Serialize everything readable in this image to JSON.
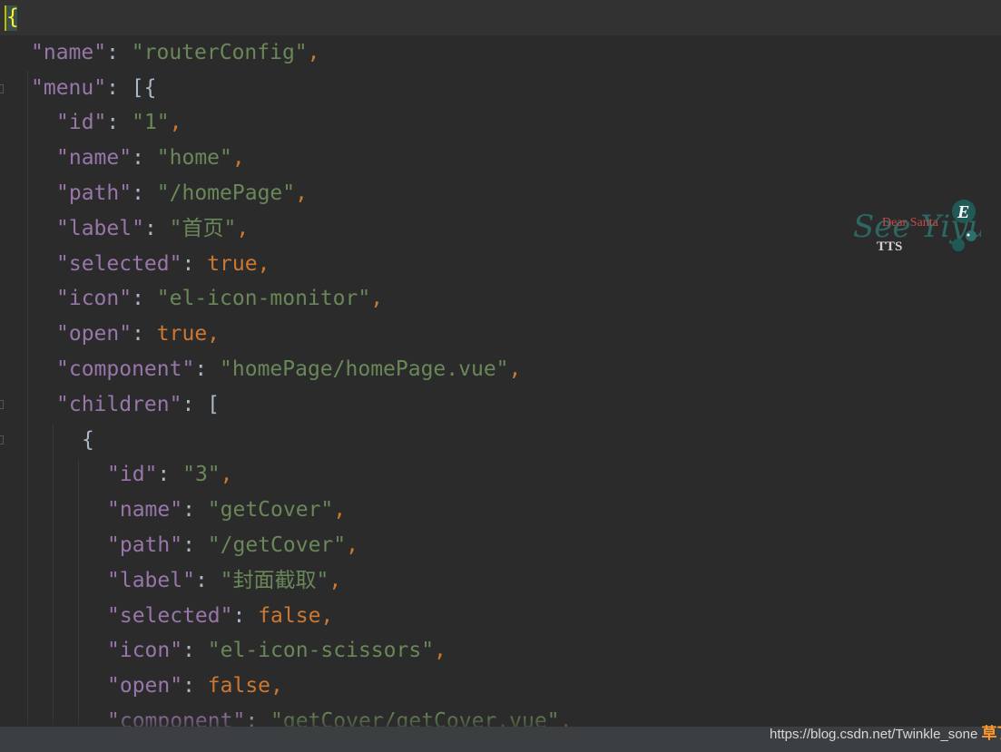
{
  "editor": {
    "lines": [
      {
        "indent": 0,
        "tokens": [
          {
            "t": "p",
            "v": "{"
          }
        ]
      },
      {
        "indent": 1,
        "tokens": [
          {
            "t": "k",
            "v": "\"name\""
          },
          {
            "t": "p",
            "v": ": "
          },
          {
            "t": "s",
            "v": "\"routerConfig\""
          },
          {
            "t": "b",
            "v": ","
          }
        ]
      },
      {
        "indent": 1,
        "tokens": [
          {
            "t": "k",
            "v": "\"menu\""
          },
          {
            "t": "p",
            "v": ": [{"
          }
        ]
      },
      {
        "indent": 2,
        "tokens": [
          {
            "t": "k",
            "v": "\"id\""
          },
          {
            "t": "p",
            "v": ": "
          },
          {
            "t": "s",
            "v": "\"1\""
          },
          {
            "t": "b",
            "v": ","
          }
        ]
      },
      {
        "indent": 2,
        "tokens": [
          {
            "t": "k",
            "v": "\"name\""
          },
          {
            "t": "p",
            "v": ": "
          },
          {
            "t": "s",
            "v": "\"home\""
          },
          {
            "t": "b",
            "v": ","
          }
        ]
      },
      {
        "indent": 2,
        "tokens": [
          {
            "t": "k",
            "v": "\"path\""
          },
          {
            "t": "p",
            "v": ": "
          },
          {
            "t": "s",
            "v": "\"/homePage\""
          },
          {
            "t": "b",
            "v": ","
          }
        ]
      },
      {
        "indent": 2,
        "tokens": [
          {
            "t": "k",
            "v": "\"label\""
          },
          {
            "t": "p",
            "v": ": "
          },
          {
            "t": "s",
            "v": "\"首页\""
          },
          {
            "t": "b",
            "v": ","
          }
        ]
      },
      {
        "indent": 2,
        "tokens": [
          {
            "t": "k",
            "v": "\"selected\""
          },
          {
            "t": "p",
            "v": ": "
          },
          {
            "t": "b",
            "v": "true,"
          }
        ]
      },
      {
        "indent": 2,
        "tokens": [
          {
            "t": "k",
            "v": "\"icon\""
          },
          {
            "t": "p",
            "v": ": "
          },
          {
            "t": "s",
            "v": "\"el-icon-monitor\""
          },
          {
            "t": "b",
            "v": ","
          }
        ]
      },
      {
        "indent": 2,
        "tokens": [
          {
            "t": "k",
            "v": "\"open\""
          },
          {
            "t": "p",
            "v": ": "
          },
          {
            "t": "b",
            "v": "true,"
          }
        ]
      },
      {
        "indent": 2,
        "tokens": [
          {
            "t": "k",
            "v": "\"component\""
          },
          {
            "t": "p",
            "v": ": "
          },
          {
            "t": "s",
            "v": "\"homePage/homePage.vue\""
          },
          {
            "t": "b",
            "v": ","
          }
        ]
      },
      {
        "indent": 2,
        "tokens": [
          {
            "t": "k",
            "v": "\"children\""
          },
          {
            "t": "p",
            "v": ": ["
          }
        ]
      },
      {
        "indent": 3,
        "tokens": [
          {
            "t": "p",
            "v": "{"
          }
        ]
      },
      {
        "indent": 4,
        "tokens": [
          {
            "t": "k",
            "v": "\"id\""
          },
          {
            "t": "p",
            "v": ": "
          },
          {
            "t": "s",
            "v": "\"3\""
          },
          {
            "t": "b",
            "v": ","
          }
        ]
      },
      {
        "indent": 4,
        "tokens": [
          {
            "t": "k",
            "v": "\"name\""
          },
          {
            "t": "p",
            "v": ": "
          },
          {
            "t": "s",
            "v": "\"getCover\""
          },
          {
            "t": "b",
            "v": ","
          }
        ]
      },
      {
        "indent": 4,
        "tokens": [
          {
            "t": "k",
            "v": "\"path\""
          },
          {
            "t": "p",
            "v": ": "
          },
          {
            "t": "s",
            "v": "\"/getCover\""
          },
          {
            "t": "b",
            "v": ","
          }
        ]
      },
      {
        "indent": 4,
        "tokens": [
          {
            "t": "k",
            "v": "\"label\""
          },
          {
            "t": "p",
            "v": ": "
          },
          {
            "t": "s",
            "v": "\"封面截取\""
          },
          {
            "t": "b",
            "v": ","
          }
        ]
      },
      {
        "indent": 4,
        "tokens": [
          {
            "t": "k",
            "v": "\"selected\""
          },
          {
            "t": "p",
            "v": ": "
          },
          {
            "t": "b",
            "v": "false,"
          }
        ]
      },
      {
        "indent": 4,
        "tokens": [
          {
            "t": "k",
            "v": "\"icon\""
          },
          {
            "t": "p",
            "v": ": "
          },
          {
            "t": "s",
            "v": "\"el-icon-scissors\""
          },
          {
            "t": "b",
            "v": ","
          }
        ]
      },
      {
        "indent": 4,
        "tokens": [
          {
            "t": "k",
            "v": "\"open\""
          },
          {
            "t": "p",
            "v": ": "
          },
          {
            "t": "b",
            "v": "false,"
          }
        ]
      },
      {
        "indent": 4,
        "tokens": [
          {
            "t": "k",
            "v": "\"component\""
          },
          {
            "t": "p",
            "v": ": "
          },
          {
            "t": "s",
            "v": "\"getCover/getCover.vue\""
          },
          {
            "t": "b",
            "v": ","
          }
        ]
      }
    ]
  },
  "colors": {
    "background": "#2b2b2b",
    "key": "#9876aa",
    "string": "#6a8759",
    "keyword": "#cc7832",
    "punctuation": "#a9b7c6"
  },
  "watermark": {
    "logo_text": "Dear Santa",
    "logo_text_2": "TTS",
    "logo_letter": "E"
  },
  "credit": {
    "url": "https://blog.csdn.net/Twinkle_sone",
    "tag": "草丁图书馆"
  }
}
